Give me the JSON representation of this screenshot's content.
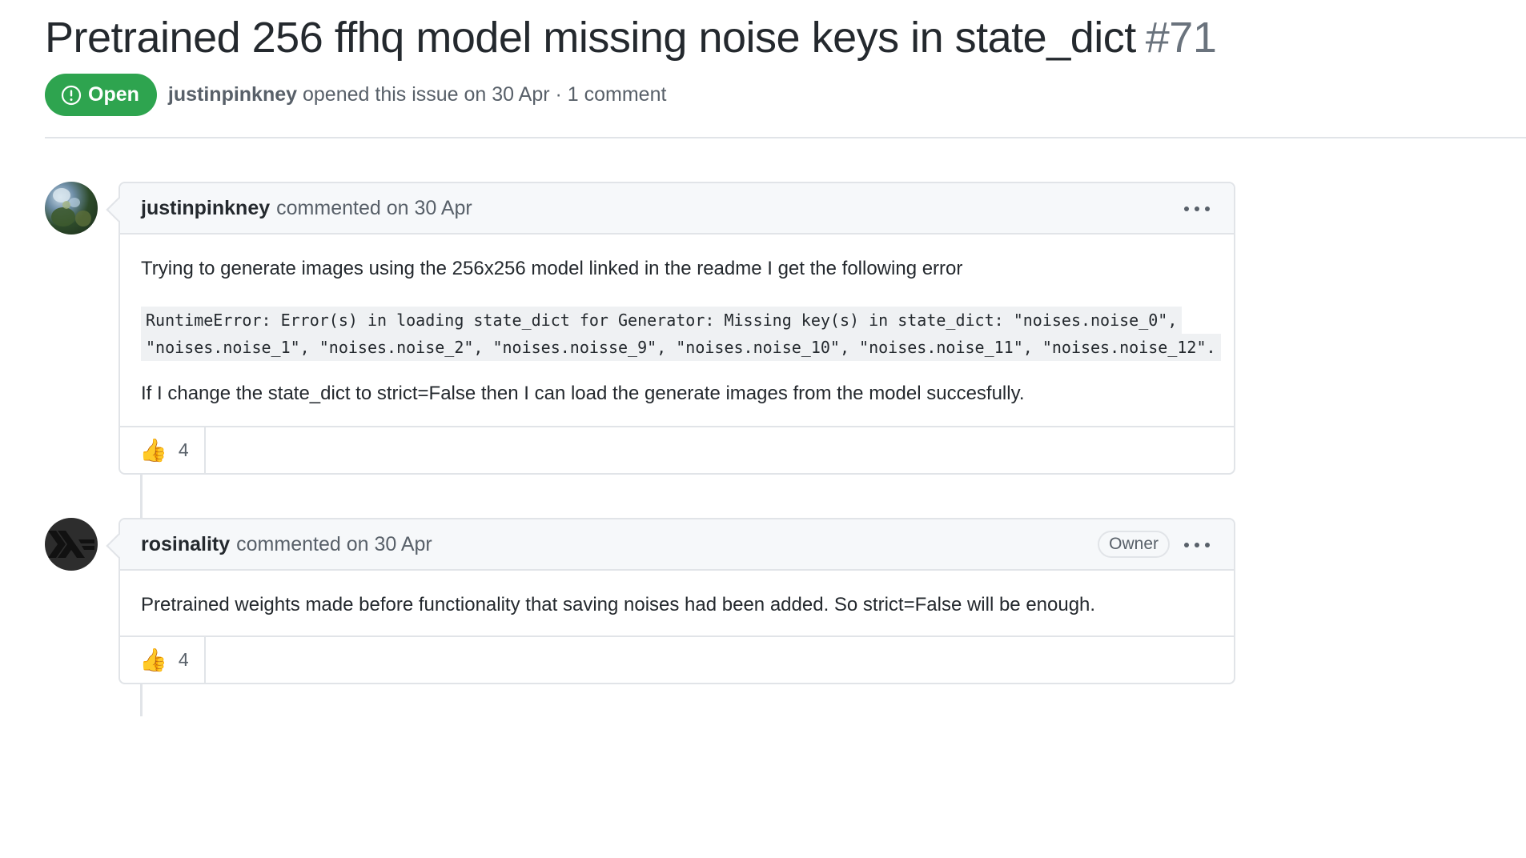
{
  "issue": {
    "title": "Pretrained 256 ffhq model missing noise keys in state_dict",
    "number": "#71",
    "state": "Open",
    "author": "justinpinkney",
    "opened_text": "opened this issue on 30 Apr · 1 comment"
  },
  "colors": {
    "open_badge": "#2ea44f",
    "header_bg": "#f6f8fa",
    "border": "#e1e4e8"
  },
  "comments": [
    {
      "author": "justinpinkney",
      "meta": "commented on 30 Apr",
      "body_intro": "Trying to generate images using the 256x256 model linked in the readme I get the following error",
      "code_lines": [
        "RuntimeError: Error(s) in loading state_dict for Generator: Missing key(s) in state_dict: \"noises.noise_0\",",
        "\"noises.noise_1\", \"noises.noise_2\", \"noises.noisse_9\", \"noises.noise_10\", \"noises.noise_11\", \"noises.noise_12\"."
      ],
      "body_outro": "If I change the state_dict to strict=False then I can load the generate images from the model succesfully.",
      "reaction_icon": "thumbs-up-icon",
      "reaction_emoji": "👍",
      "reaction_count": "4"
    },
    {
      "author": "rosinality",
      "meta": "commented on 30 Apr",
      "badge": "Owner",
      "body": "Pretrained weights made before functionality that saving noises had been added. So strict=False will be enough.",
      "reaction_icon": "thumbs-up-icon",
      "reaction_emoji": "👍",
      "reaction_count": "4"
    }
  ]
}
